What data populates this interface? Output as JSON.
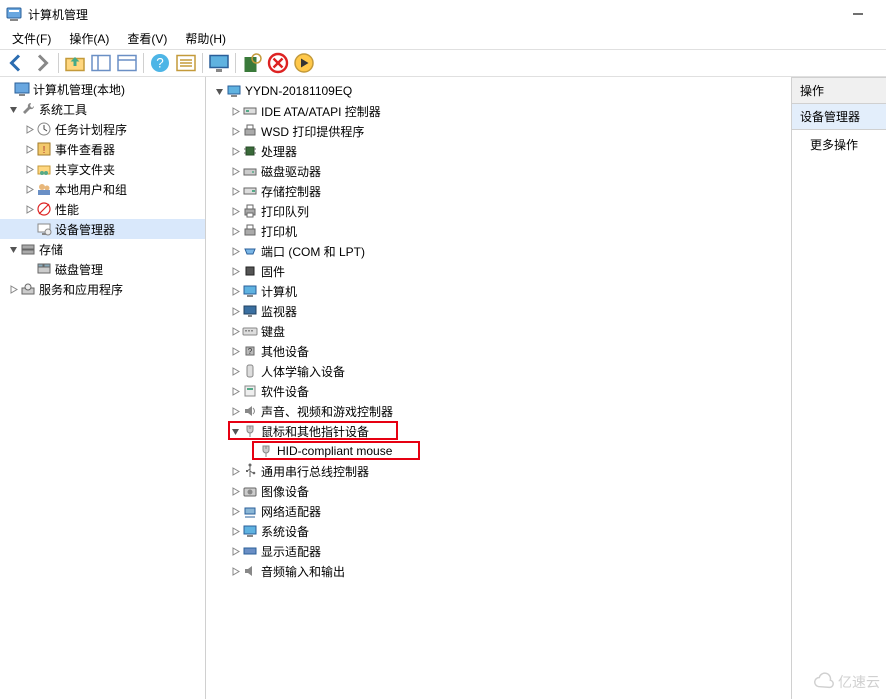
{
  "window": {
    "title": "计算机管理",
    "minimize": "—"
  },
  "menubar": {
    "file": "文件(F)",
    "action": "操作(A)",
    "view": "查看(V)",
    "help": "帮助(H)"
  },
  "left_tree": {
    "root": "计算机管理(本地)",
    "system_tools": "系统工具",
    "task_scheduler": "任务计划程序",
    "event_viewer": "事件查看器",
    "shared_folders": "共享文件夹",
    "local_users": "本地用户和组",
    "performance": "性能",
    "device_manager": "设备管理器",
    "storage": "存储",
    "disk_mgmt": "磁盘管理",
    "services_apps": "服务和应用程序"
  },
  "device_tree": {
    "root": "YYDN-20181109EQ",
    "ide": "IDE ATA/ATAPI 控制器",
    "wsd": "WSD 打印提供程序",
    "cpu": "处理器",
    "disk_drives": "磁盘驱动器",
    "storage_ctrl": "存储控制器",
    "print_queue": "打印队列",
    "printers": "打印机",
    "ports": "端口 (COM 和 LPT)",
    "firmware": "固件",
    "computer": "计算机",
    "monitors": "监视器",
    "keyboards": "键盘",
    "other": "其他设备",
    "hid": "人体学输入设备",
    "software_dev": "软件设备",
    "sound": "声音、视频和游戏控制器",
    "mouse_category": "鼠标和其他指针设备",
    "hid_mouse": "HID-compliant mouse",
    "usb_ctrl": "通用串行总线控制器",
    "imaging": "图像设备",
    "net_adapters": "网络适配器",
    "system_dev": "系统设备",
    "display": "显示适配器",
    "audio_io": "音频输入和输出"
  },
  "actions": {
    "header": "操作",
    "section": "设备管理器",
    "more": "更多操作"
  },
  "watermark": "亿速云"
}
